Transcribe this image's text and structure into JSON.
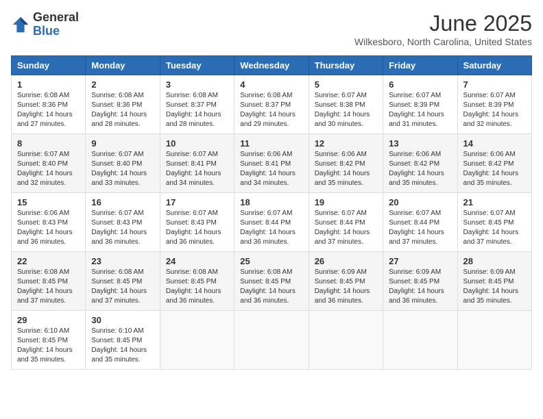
{
  "header": {
    "logo_line1": "General",
    "logo_line2": "Blue",
    "title": "June 2025",
    "subtitle": "Wilkesboro, North Carolina, United States"
  },
  "days_of_week": [
    "Sunday",
    "Monday",
    "Tuesday",
    "Wednesday",
    "Thursday",
    "Friday",
    "Saturday"
  ],
  "weeks": [
    [
      {
        "day": "1",
        "sunrise": "6:08 AM",
        "sunset": "8:36 PM",
        "daylight": "14 hours and 27 minutes."
      },
      {
        "day": "2",
        "sunrise": "6:08 AM",
        "sunset": "8:36 PM",
        "daylight": "14 hours and 28 minutes."
      },
      {
        "day": "3",
        "sunrise": "6:08 AM",
        "sunset": "8:37 PM",
        "daylight": "14 hours and 28 minutes."
      },
      {
        "day": "4",
        "sunrise": "6:08 AM",
        "sunset": "8:37 PM",
        "daylight": "14 hours and 29 minutes."
      },
      {
        "day": "5",
        "sunrise": "6:07 AM",
        "sunset": "8:38 PM",
        "daylight": "14 hours and 30 minutes."
      },
      {
        "day": "6",
        "sunrise": "6:07 AM",
        "sunset": "8:39 PM",
        "daylight": "14 hours and 31 minutes."
      },
      {
        "day": "7",
        "sunrise": "6:07 AM",
        "sunset": "8:39 PM",
        "daylight": "14 hours and 32 minutes."
      }
    ],
    [
      {
        "day": "8",
        "sunrise": "6:07 AM",
        "sunset": "8:40 PM",
        "daylight": "14 hours and 32 minutes."
      },
      {
        "day": "9",
        "sunrise": "6:07 AM",
        "sunset": "8:40 PM",
        "daylight": "14 hours and 33 minutes."
      },
      {
        "day": "10",
        "sunrise": "6:07 AM",
        "sunset": "8:41 PM",
        "daylight": "14 hours and 34 minutes."
      },
      {
        "day": "11",
        "sunrise": "6:06 AM",
        "sunset": "8:41 PM",
        "daylight": "14 hours and 34 minutes."
      },
      {
        "day": "12",
        "sunrise": "6:06 AM",
        "sunset": "8:42 PM",
        "daylight": "14 hours and 35 minutes."
      },
      {
        "day": "13",
        "sunrise": "6:06 AM",
        "sunset": "8:42 PM",
        "daylight": "14 hours and 35 minutes."
      },
      {
        "day": "14",
        "sunrise": "6:06 AM",
        "sunset": "8:42 PM",
        "daylight": "14 hours and 35 minutes."
      }
    ],
    [
      {
        "day": "15",
        "sunrise": "6:06 AM",
        "sunset": "8:43 PM",
        "daylight": "14 hours and 36 minutes."
      },
      {
        "day": "16",
        "sunrise": "6:07 AM",
        "sunset": "8:43 PM",
        "daylight": "14 hours and 36 minutes."
      },
      {
        "day": "17",
        "sunrise": "6:07 AM",
        "sunset": "8:43 PM",
        "daylight": "14 hours and 36 minutes."
      },
      {
        "day": "18",
        "sunrise": "6:07 AM",
        "sunset": "8:44 PM",
        "daylight": "14 hours and 36 minutes."
      },
      {
        "day": "19",
        "sunrise": "6:07 AM",
        "sunset": "8:44 PM",
        "daylight": "14 hours and 37 minutes."
      },
      {
        "day": "20",
        "sunrise": "6:07 AM",
        "sunset": "8:44 PM",
        "daylight": "14 hours and 37 minutes."
      },
      {
        "day": "21",
        "sunrise": "6:07 AM",
        "sunset": "8:45 PM",
        "daylight": "14 hours and 37 minutes."
      }
    ],
    [
      {
        "day": "22",
        "sunrise": "6:08 AM",
        "sunset": "8:45 PM",
        "daylight": "14 hours and 37 minutes."
      },
      {
        "day": "23",
        "sunrise": "6:08 AM",
        "sunset": "8:45 PM",
        "daylight": "14 hours and 37 minutes."
      },
      {
        "day": "24",
        "sunrise": "6:08 AM",
        "sunset": "8:45 PM",
        "daylight": "14 hours and 36 minutes."
      },
      {
        "day": "25",
        "sunrise": "6:08 AM",
        "sunset": "8:45 PM",
        "daylight": "14 hours and 36 minutes."
      },
      {
        "day": "26",
        "sunrise": "6:09 AM",
        "sunset": "8:45 PM",
        "daylight": "14 hours and 36 minutes."
      },
      {
        "day": "27",
        "sunrise": "6:09 AM",
        "sunset": "8:45 PM",
        "daylight": "14 hours and 36 minutes."
      },
      {
        "day": "28",
        "sunrise": "6:09 AM",
        "sunset": "8:45 PM",
        "daylight": "14 hours and 35 minutes."
      }
    ],
    [
      {
        "day": "29",
        "sunrise": "6:10 AM",
        "sunset": "8:45 PM",
        "daylight": "14 hours and 35 minutes."
      },
      {
        "day": "30",
        "sunrise": "6:10 AM",
        "sunset": "8:45 PM",
        "daylight": "14 hours and 35 minutes."
      },
      null,
      null,
      null,
      null,
      null
    ]
  ]
}
